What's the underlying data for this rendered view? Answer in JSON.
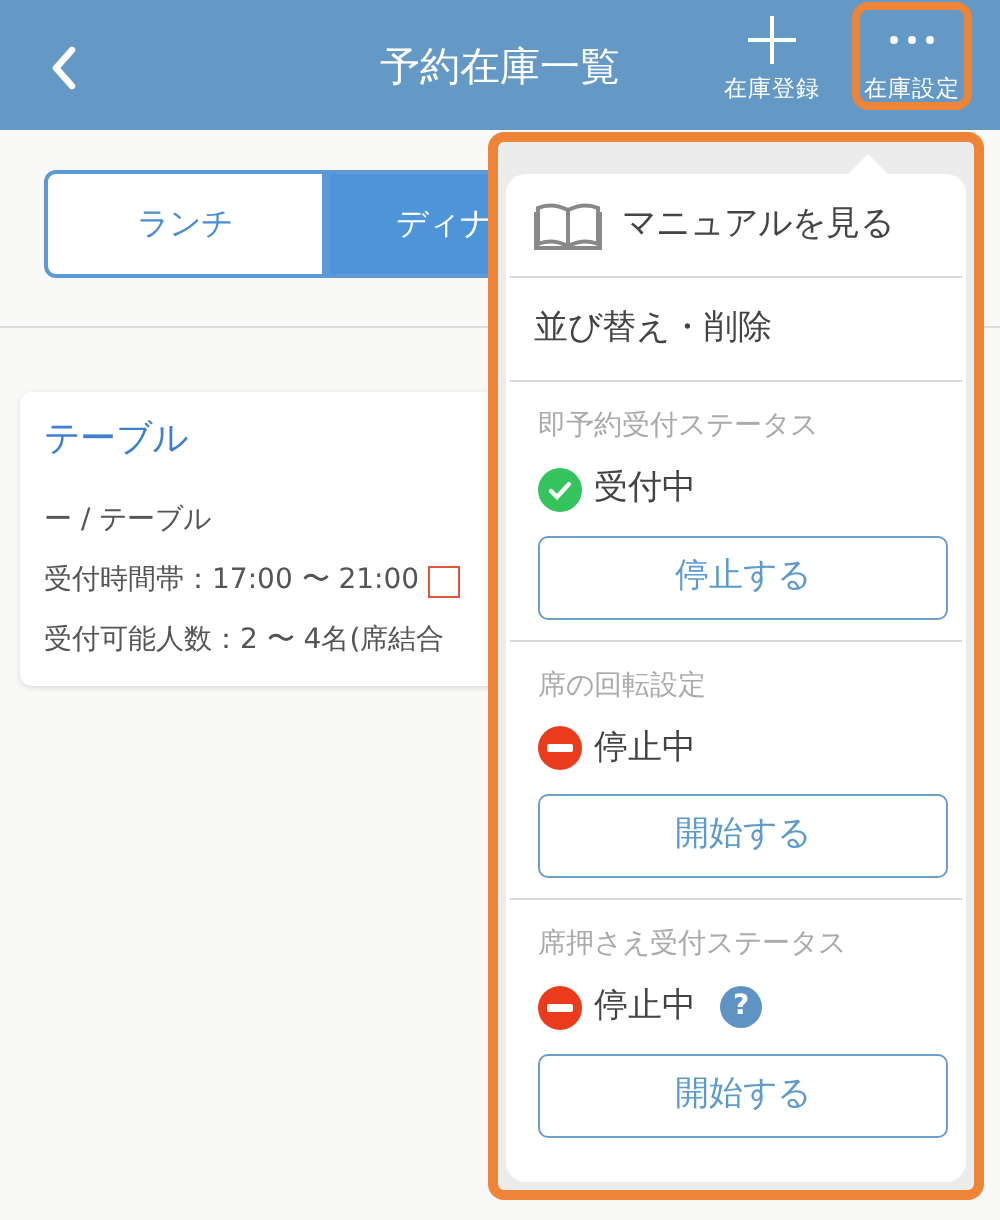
{
  "header": {
    "title": "予約在庫一覧",
    "actions": [
      {
        "kind": "add",
        "label": "在庫登録",
        "highlighted": false
      },
      {
        "kind": "more",
        "label": "在庫設定",
        "highlighted": true
      }
    ]
  },
  "segments": [
    {
      "label": "ランチ",
      "selected": false
    },
    {
      "label": "ディナ",
      "selected": true
    }
  ],
  "card": {
    "title": "テーブル",
    "lines": [
      {
        "text": "ー / テーブル",
        "flag": false
      },
      {
        "text": "受付時間帯：17:00 〜 21:00",
        "flag": true
      },
      {
        "text": "受付可能人数：2 〜 4名(席結合",
        "flag": false
      }
    ]
  },
  "menu": {
    "highlighted": true,
    "items": [
      {
        "kind": "link",
        "icon": true,
        "label": "マニュアルを見る"
      },
      {
        "kind": "link",
        "icon": false,
        "label": "並び替え・削除"
      },
      {
        "kind": "status",
        "title": "即予約受付ステータス",
        "status": "受付中",
        "active": true,
        "button": "停止する"
      },
      {
        "kind": "status",
        "title": "席の回転設定",
        "status": "停止中",
        "active": false,
        "button": "開始する"
      },
      {
        "kind": "status",
        "title": "席押さえ受付ステータス",
        "status": "停止中",
        "active": false,
        "help": "?",
        "button": "開始する"
      }
    ]
  }
}
